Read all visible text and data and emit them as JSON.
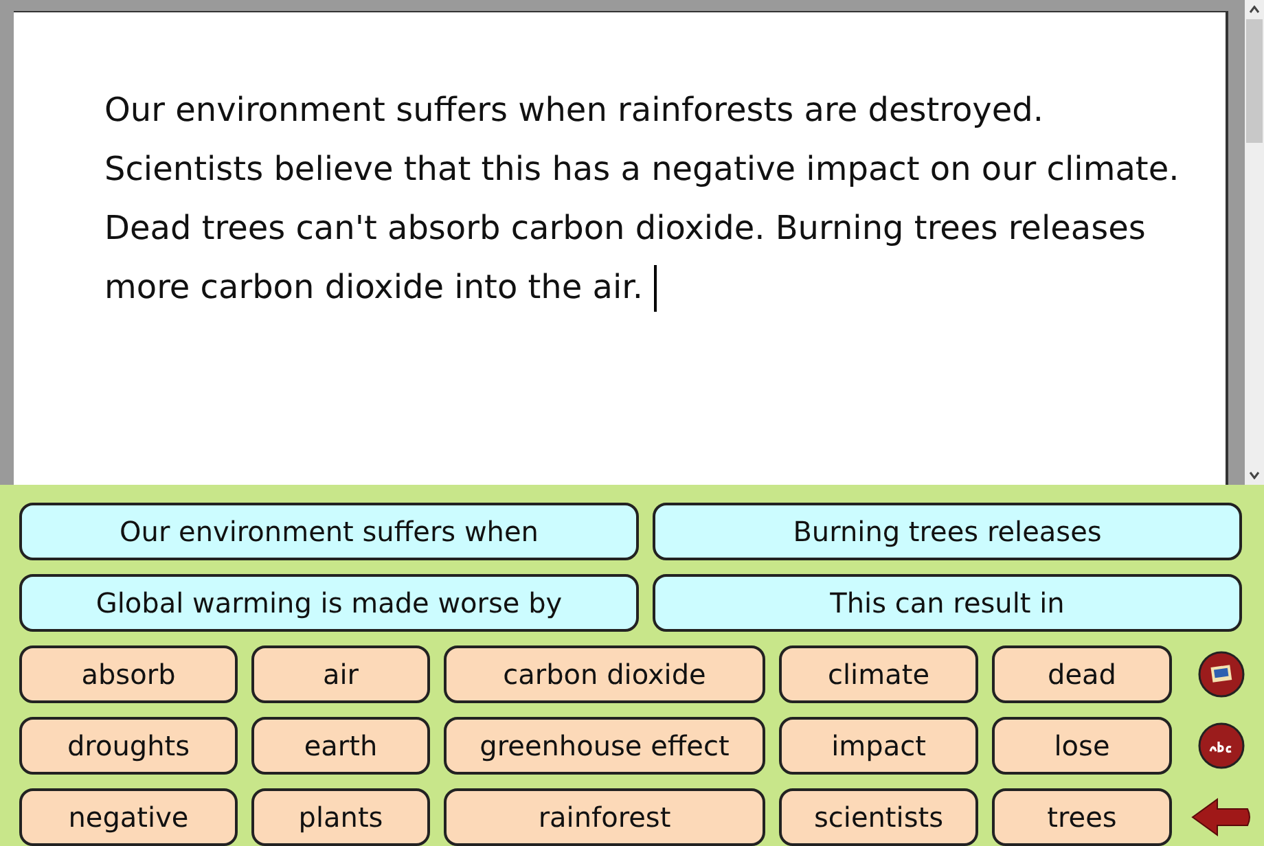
{
  "document": {
    "text": "Our environment suffers when rainforests are destroyed. Scientists believe that this has a negative impact on our climate. Dead trees can't absorb carbon dioxide. Burning trees releases more carbon dioxide into the air."
  },
  "phrases": [
    "Our environment suffers when",
    "Burning trees releases",
    "Global warming is made worse by",
    "This can result in"
  ],
  "words": [
    "absorb",
    "air",
    "carbon dioxide",
    "climate",
    "dead",
    "droughts",
    "earth",
    "greenhouse effect",
    "impact",
    "lose",
    "negative",
    "plants",
    "rainforest",
    "scientists",
    "trees"
  ],
  "tools": [
    {
      "kind": "picture"
    },
    {
      "kind": "spelling"
    },
    {
      "kind": "back"
    }
  ]
}
